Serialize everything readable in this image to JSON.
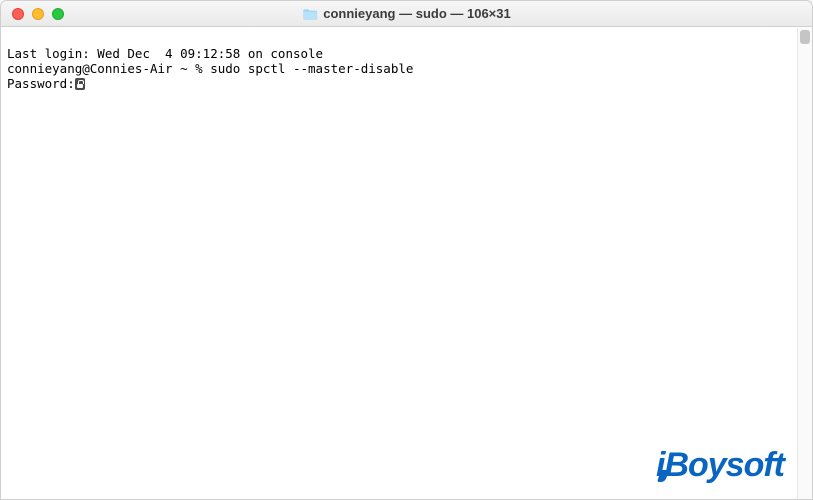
{
  "titlebar": {
    "title": "connieyang — sudo — 106×31"
  },
  "terminal": {
    "line1": "Last login: Wed Dec  4 09:12:58 on console",
    "line2_prompt": "connieyang@Connies-Air ~ % ",
    "line2_cmd": "sudo spctl --master-disable",
    "line3_label": "Password:"
  },
  "watermark": {
    "text": "iBoysoft"
  }
}
